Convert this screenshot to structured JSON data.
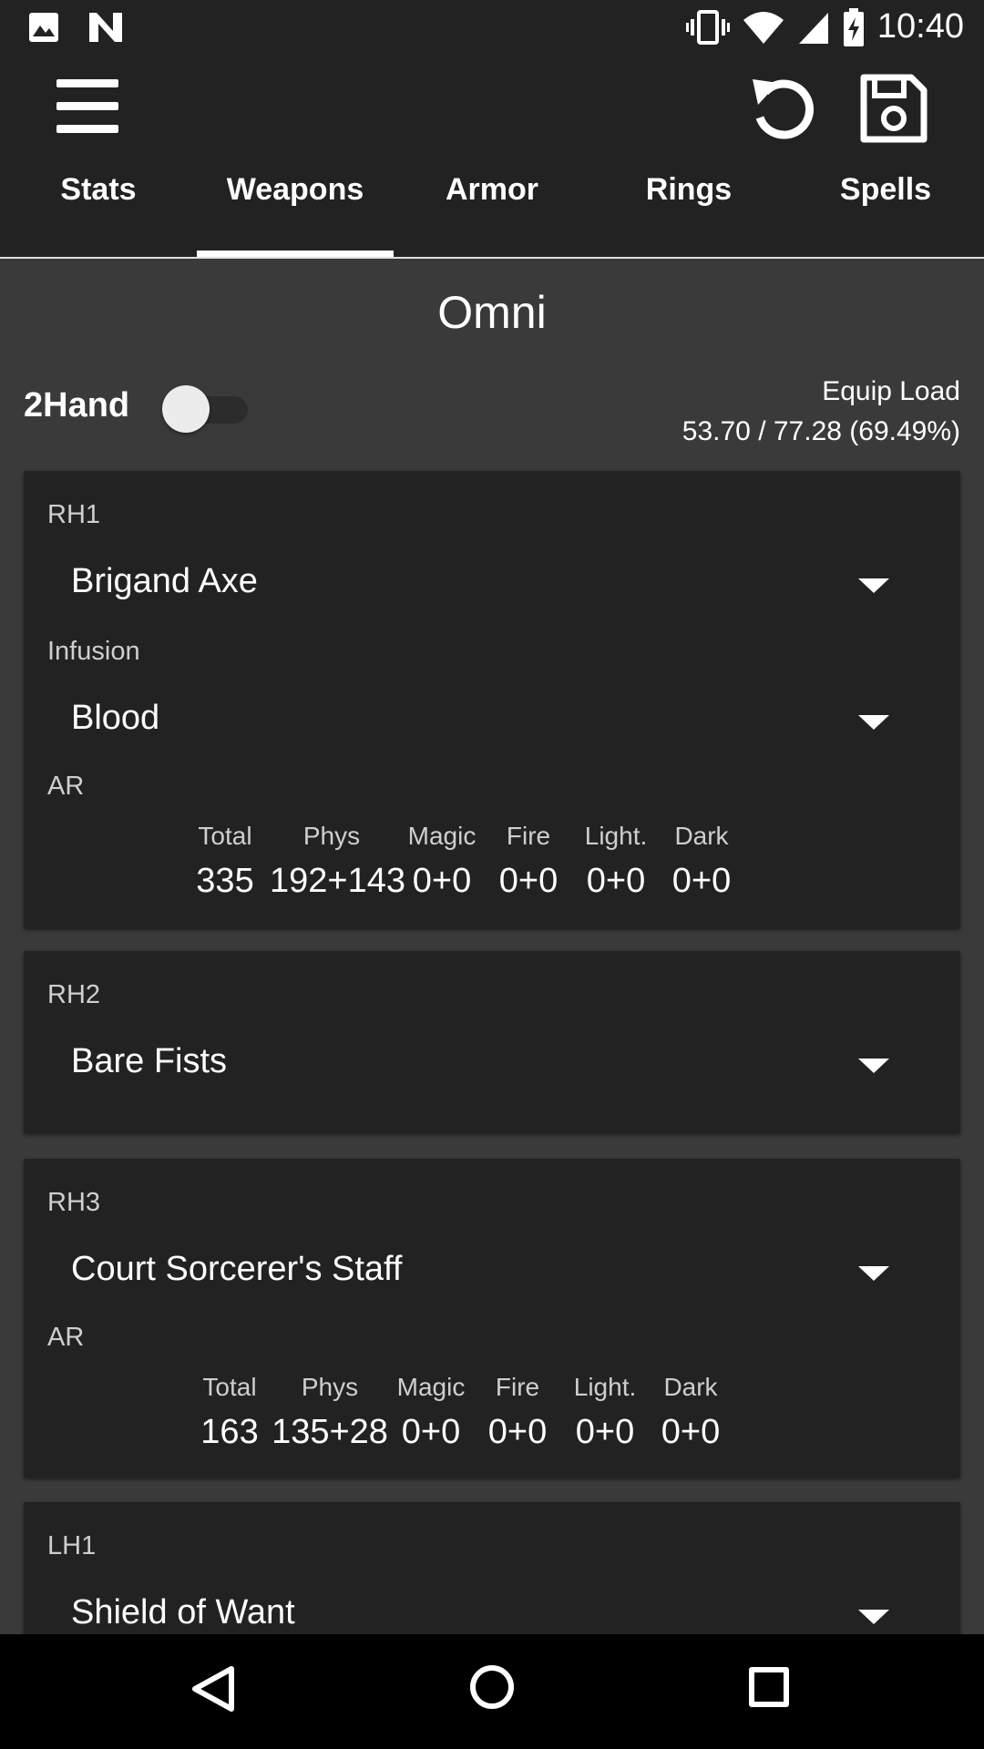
{
  "status_bar": {
    "time": "10:40"
  },
  "tabs": [
    {
      "label": "Stats"
    },
    {
      "label": "Weapons"
    },
    {
      "label": "Armor"
    },
    {
      "label": "Rings"
    },
    {
      "label": "Spells"
    }
  ],
  "active_tab": "Weapons",
  "character_name": "Omni",
  "two_hand": {
    "label": "2Hand",
    "enabled": false
  },
  "equip_load": {
    "title": "Equip Load",
    "value": "53.70 / 77.28 (69.49%)"
  },
  "cards": {
    "rh1": {
      "slot": "RH1",
      "weapon": "Brigand Axe",
      "infusion_label": "Infusion",
      "infusion": "Blood",
      "ar_label": "AR",
      "ar": {
        "headers": [
          "Total",
          "Phys",
          "Magic",
          "Fire",
          "Light.",
          "Dark"
        ],
        "values": [
          "335",
          "192+143",
          "0+0",
          "0+0",
          "0+0",
          "0+0"
        ]
      }
    },
    "rh2": {
      "slot": "RH2",
      "weapon": "Bare Fists"
    },
    "rh3": {
      "slot": "RH3",
      "weapon": "Court Sorcerer's Staff",
      "ar_label": "AR",
      "ar": {
        "headers": [
          "Total",
          "Phys",
          "Magic",
          "Fire",
          "Light.",
          "Dark"
        ],
        "values": [
          "163",
          "135+28",
          "0+0",
          "0+0",
          "0+0",
          "0+0"
        ]
      }
    },
    "lh1": {
      "slot": "LH1",
      "weapon": "Shield of Want"
    }
  },
  "colors": {
    "background": "#3a3a3a",
    "card": "#222222",
    "appbar": "#222222",
    "accent": "#ffffff"
  }
}
